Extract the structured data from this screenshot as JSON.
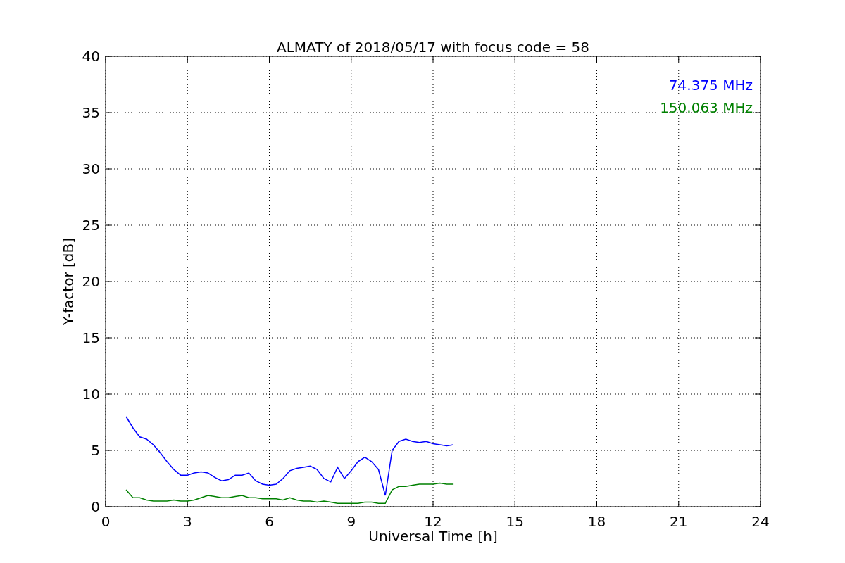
{
  "chart_data": {
    "type": "line",
    "grid": true,
    "title": "ALMATY of 2018/05/17 with focus code = 58",
    "xlabel": "Universal Time [h]",
    "ylabel": "Y-factor [dB]",
    "xlim": [
      0,
      24
    ],
    "ylim": [
      0,
      40
    ],
    "xticks": [
      0,
      3,
      6,
      9,
      12,
      15,
      18,
      21,
      24
    ],
    "yticks": [
      0,
      5,
      10,
      15,
      20,
      25,
      30,
      35,
      40
    ],
    "x": [
      0.75,
      1.0,
      1.25,
      1.5,
      1.75,
      2.0,
      2.25,
      2.5,
      2.75,
      3.0,
      3.25,
      3.5,
      3.75,
      4.0,
      4.25,
      4.5,
      4.75,
      5.0,
      5.25,
      5.5,
      5.75,
      6.0,
      6.25,
      6.5,
      6.75,
      7.0,
      7.25,
      7.5,
      7.75,
      8.0,
      8.25,
      8.5,
      8.75,
      9.0,
      9.25,
      9.5,
      9.75,
      10.0,
      10.25,
      10.5,
      10.75,
      11.0,
      11.25,
      11.5,
      11.75,
      12.0,
      12.25,
      12.5,
      12.75
    ],
    "series": [
      {
        "name": "74.375 MHz",
        "color": "#0000ff",
        "values": [
          8.0,
          7.0,
          6.2,
          6.0,
          5.5,
          4.8,
          4.0,
          3.3,
          2.8,
          2.8,
          3.0,
          3.1,
          3.0,
          2.6,
          2.3,
          2.4,
          2.8,
          2.8,
          3.0,
          2.3,
          2.0,
          1.9,
          2.0,
          2.5,
          3.2,
          3.4,
          3.5,
          3.6,
          3.3,
          2.5,
          2.2,
          3.5,
          2.5,
          3.2,
          4.0,
          4.4,
          4.0,
          3.3,
          1.0,
          5.0,
          5.8,
          6.0,
          5.8,
          5.7,
          5.8,
          5.6,
          5.5,
          5.4,
          5.5
        ]
      },
      {
        "name": "150.063 MHz",
        "color": "#008000",
        "values": [
          1.5,
          0.8,
          0.8,
          0.6,
          0.5,
          0.5,
          0.5,
          0.6,
          0.5,
          0.5,
          0.6,
          0.8,
          1.0,
          0.9,
          0.8,
          0.8,
          0.9,
          1.0,
          0.8,
          0.8,
          0.7,
          0.7,
          0.7,
          0.6,
          0.8,
          0.6,
          0.5,
          0.5,
          0.4,
          0.5,
          0.4,
          0.3,
          0.3,
          0.3,
          0.3,
          0.4,
          0.4,
          0.3,
          0.3,
          1.5,
          1.8,
          1.8,
          1.9,
          2.0,
          2.0,
          2.0,
          2.1,
          2.0,
          2.0
        ]
      }
    ]
  }
}
